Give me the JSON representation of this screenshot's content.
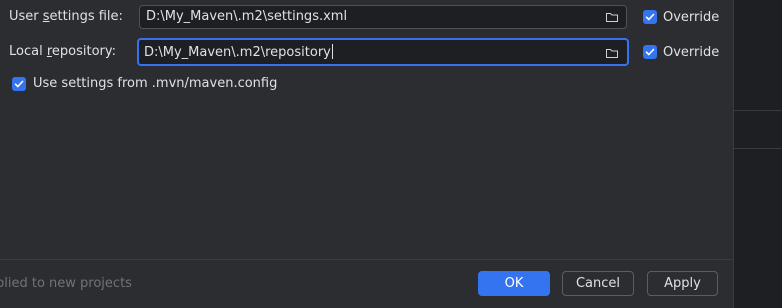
{
  "settings": {
    "user_settings": {
      "label_pre": "User ",
      "label_accel": "s",
      "label_post": "ettings file:",
      "value": "D:\\My_Maven\\.m2\\settings.xml",
      "override_label": "Override",
      "override_checked": true
    },
    "local_repo": {
      "label_pre": "Local ",
      "label_accel": "r",
      "label_post": "epository:",
      "value": "D:\\My_Maven\\.m2\\repository",
      "override_label": "Override",
      "override_checked": true
    },
    "use_mvn_config": {
      "label": "Use settings from .mvn/maven.config",
      "checked": true
    }
  },
  "footer": {
    "hint": "plied to new projects",
    "ok_label": "OK",
    "cancel_label": "Cancel",
    "apply_label": "Apply"
  },
  "icons": {
    "folder": "folder-icon",
    "check": "checkmark-icon"
  },
  "colors": {
    "accent": "#3574f0",
    "background": "#2b2d30",
    "field_bg": "#1e1f22"
  }
}
